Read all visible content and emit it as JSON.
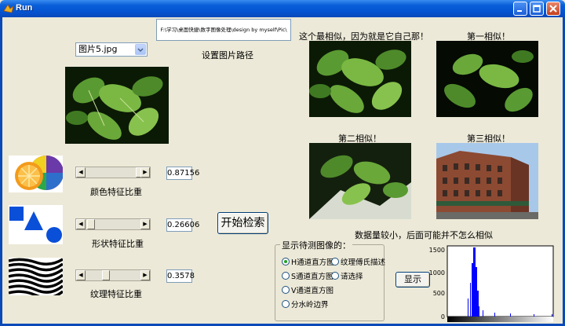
{
  "window": {
    "title": "Run"
  },
  "path": {
    "value": "F:\\学习\\桌面快捷\\数字图像处理\\design by myself\\Pic\\"
  },
  "path_label": "设置图片路径",
  "image_select": {
    "value": "图片5.jpg"
  },
  "features": [
    {
      "label": "颜色特征比重",
      "value": "0.87156",
      "level": 0.87
    },
    {
      "label": "形状特征比重",
      "value": "0.26606",
      "level": 0.27
    },
    {
      "label": "纹理特征比重",
      "value": "0.3578",
      "level": 0.36
    }
  ],
  "search_button": "开始检索",
  "results": {
    "best_label": "这个最相似，因为就是它自己那！",
    "first_label": "第一相似！",
    "second_label": "第二相似！",
    "third_label": "第三相似！",
    "note": "数据量较小，后面可能并不怎么相似"
  },
  "display_group": {
    "title": "显示待测图像的：",
    "options": [
      "H通道直方图",
      "纹理傅氏描述",
      "S通道直方图",
      "请选择",
      "V通道直方图",
      "分水岭边界"
    ],
    "selected": "H通道直方图"
  },
  "show_button": "显示",
  "histogram": {
    "yticks": [
      "1500",
      "1000",
      "500",
      "0"
    ],
    "ylim": [
      0,
      1500
    ]
  },
  "colors": {
    "titlebar": "#0553d1",
    "face": "#ece9d8",
    "bar": "#0000ff"
  }
}
